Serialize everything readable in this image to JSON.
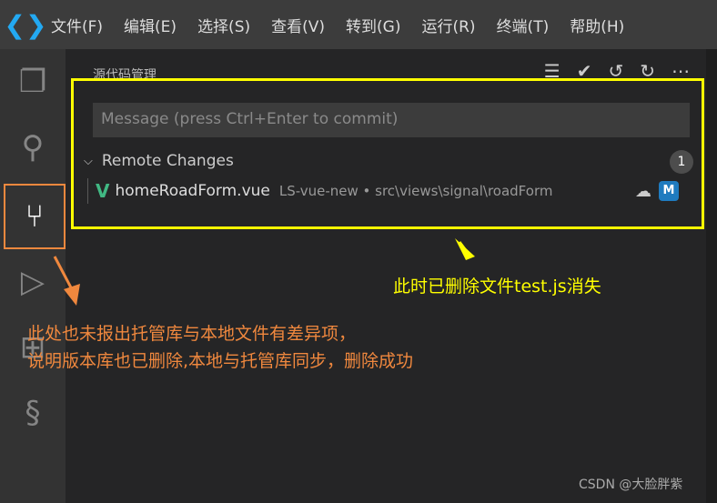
{
  "menubar": {
    "items": [
      "文件(F)",
      "编辑(E)",
      "选择(S)",
      "查看(V)",
      "转到(G)",
      "运行(R)",
      "终端(T)",
      "帮助(H)"
    ]
  },
  "sidebar": {
    "title": "源代码管理",
    "message_placeholder": "Message (press Ctrl+Enter to commit)",
    "group": {
      "label": "Remote Changes",
      "count": "1"
    },
    "file": {
      "name": "homeRoadForm.vue",
      "path": "LS-vue-new • src\\views\\signal\\roadForm",
      "status": "M"
    }
  },
  "annotations": {
    "box_note": "此时已删除文件test.js消失",
    "line1": "此处也未报出托管库与本地文件有差异项，",
    "line2": "说明版本库也已删除,本地与托管库同步，删除成功"
  },
  "watermark": "CSDN @大脸胖紫",
  "colors": {
    "highlight_box": "#ffff00",
    "annotation_orange": "#f0883e",
    "accent": "#23a9f2"
  }
}
